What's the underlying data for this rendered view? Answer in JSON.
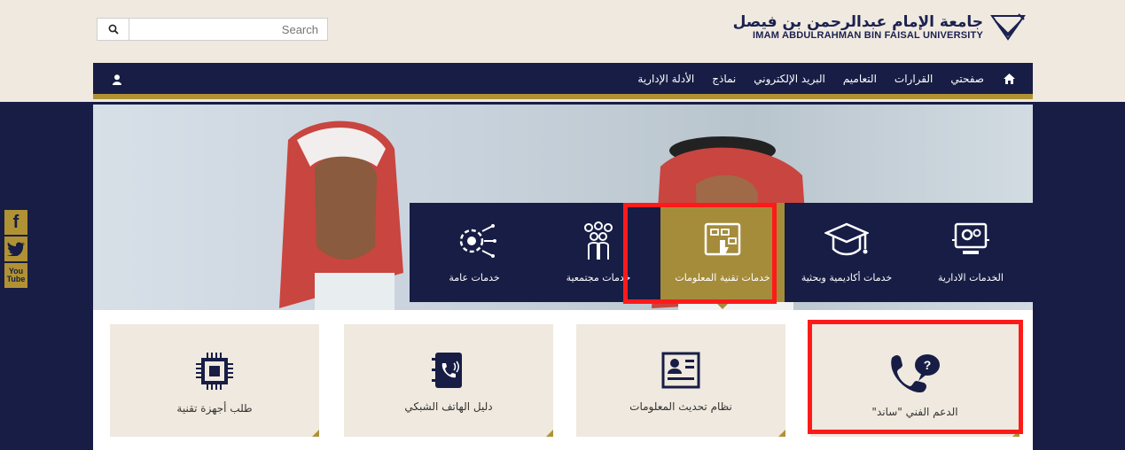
{
  "header": {
    "search_placeholder": "Search",
    "logo_ar": "جامعة الإمام عبدالرحمن بن فيصل",
    "logo_en": "IMAM ABDULRAHMAN BIN FAISAL UNIVERSITY"
  },
  "nav": {
    "items": [
      "صفحتي",
      "القرارات",
      "التعاميم",
      "البريد الإلكتروني",
      "نماذج",
      "الأدلة الإدارية"
    ]
  },
  "services": [
    {
      "label": "الخدمات الادارية",
      "icon": "admin-gears-icon"
    },
    {
      "label": "خدمات أكاديمية وبحثية",
      "icon": "graduation-cap-icon"
    },
    {
      "label": "خدمات تقنية المعلومات",
      "icon": "touch-panel-icon",
      "active": true
    },
    {
      "label": "خدمات مجتمعية",
      "icon": "people-group-icon"
    },
    {
      "label": "خدمات عامة",
      "icon": "chip-circuit-icon"
    }
  ],
  "cards": [
    {
      "label": "الدعم الفني \"ساند\"",
      "icon": "phone-support-icon"
    },
    {
      "label": "نظام تحديث المعلومات",
      "icon": "id-card-icon"
    },
    {
      "label": "دليل الهاتف الشبكي",
      "icon": "phone-book-icon"
    },
    {
      "label": "طلب أجهزة تقنية",
      "icon": "cpu-chip-icon"
    }
  ],
  "social": {
    "facebook": "f",
    "youtube_1": "You",
    "youtube_2": "Tube"
  },
  "colors": {
    "navy": "#171d45",
    "gold": "#b09235",
    "beige": "#efe9df",
    "highlight": "#ff1a1a"
  }
}
